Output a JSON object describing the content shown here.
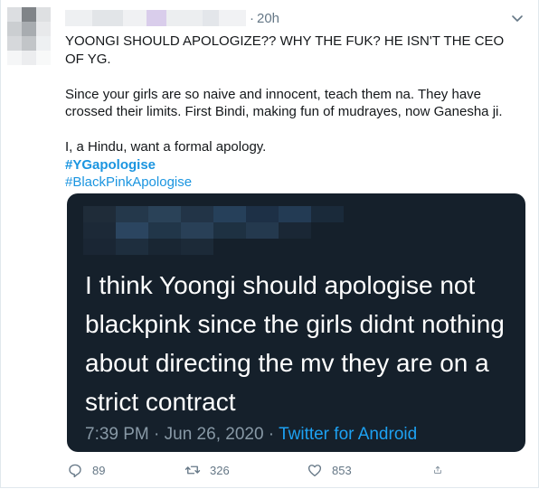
{
  "tweet": {
    "time_ago": "20h",
    "separator": "·",
    "text_lines": [
      "YOONGI SHOULD APOLOGIZE?? WHY THE FUK? HE ISN'T THE CEO OF YG.",
      "Since your girls are so naive and innocent, teach them na. They have crossed their limits. First Bindi, making fun of mudrayes, now Ganesha ji.",
      "I, a Hindu, want a formal apology."
    ],
    "hashtags": [
      "#YGapologise",
      "#BlackPinkApologise"
    ]
  },
  "embedded": {
    "text": "I think Yoongi should apologise not blackpink since the girls didnt nothing about directing the mv they are on a strict contract",
    "timestamp": "7:39 PM · Jun 26, 2020 · ",
    "source": "Twitter for Android"
  },
  "actions": {
    "reply_count": "89",
    "retweet_count": "326",
    "like_count": "853"
  },
  "colors": {
    "link": "#1b95e0",
    "card_bg": "#15202b",
    "muted": "#657786"
  },
  "icons": [
    "chevron-down-icon",
    "reply-icon",
    "retweet-icon",
    "like-icon",
    "share-icon"
  ]
}
